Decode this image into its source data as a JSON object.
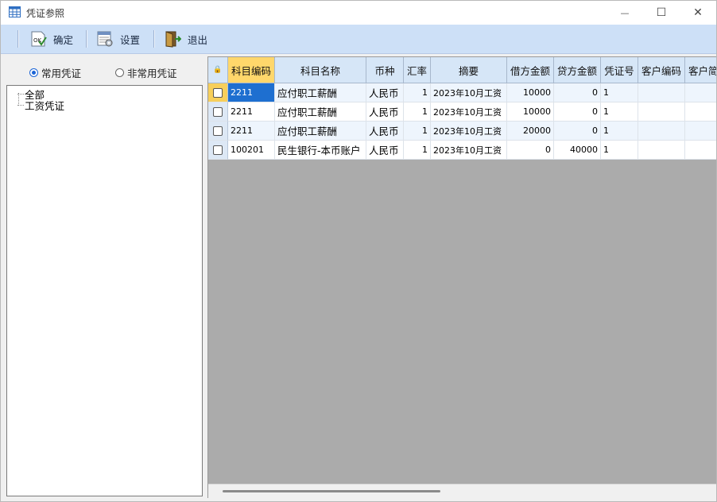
{
  "window": {
    "title": "凭证参照",
    "minimize_glyph": "—",
    "maximize_glyph": "☐",
    "close_glyph": "✕"
  },
  "toolbar": {
    "confirm_label": "确定",
    "settings_label": "设置",
    "exit_label": "退出"
  },
  "left": {
    "radio_common": "常用凭证",
    "radio_uncommon": "非常用凭证",
    "selected_radio": "radio_common",
    "tree": [
      "全部",
      "工资凭证"
    ]
  },
  "grid": {
    "lock_glyph": "🔒",
    "columns": [
      "科目编码",
      "科目名称",
      "币种",
      "汇率",
      "摘要",
      "借方金额",
      "贷方金额",
      "凭证号",
      "客户编码",
      "客户简"
    ],
    "rows": [
      {
        "code": "2211",
        "name": "应付职工薪酬",
        "currency": "人民币",
        "rate": "1",
        "summary": "2023年10月工资",
        "debit": "10000",
        "credit": "0",
        "voucher": "1"
      },
      {
        "code": "2211",
        "name": "应付职工薪酬",
        "currency": "人民币",
        "rate": "1",
        "summary": "2023年10月工资",
        "debit": "10000",
        "credit": "0",
        "voucher": "1"
      },
      {
        "code": "2211",
        "name": "应付职工薪酬",
        "currency": "人民币",
        "rate": "1",
        "summary": "2023年10月工资",
        "debit": "20000",
        "credit": "0",
        "voucher": "1"
      },
      {
        "code": "100201",
        "name": "民生银行-本币账户",
        "currency": "人民币",
        "rate": "1",
        "summary": "2023年10月工资",
        "debit": "0",
        "credit": "40000",
        "voucher": "1"
      }
    ]
  },
  "colors": {
    "toolbar_bg": "#cde0f7",
    "header_bg": "#d6e6f7",
    "selected_cell": "#1e6fd0",
    "selected_header": "#ffd76b"
  }
}
